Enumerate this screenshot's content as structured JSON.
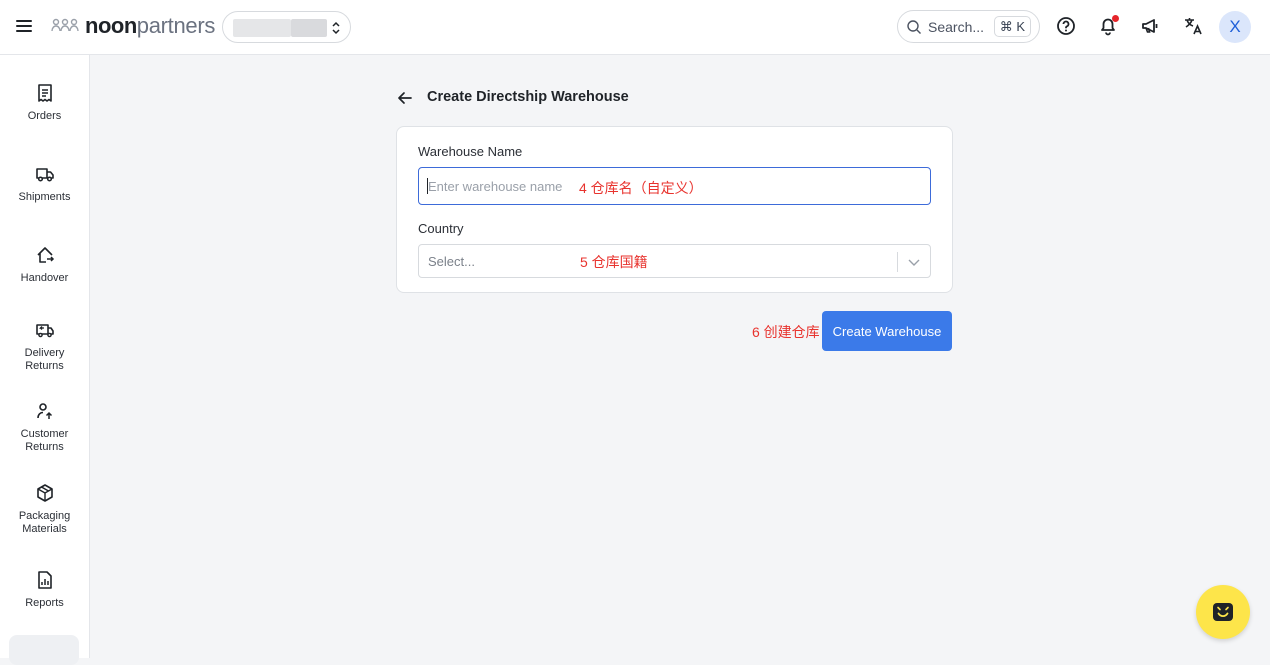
{
  "header": {
    "brand_bold": "noon",
    "brand_light": "partners",
    "search_placeholder": "Search...",
    "search_shortcut": "⌘ K",
    "avatar_initial": "X"
  },
  "sidebar": {
    "items": [
      {
        "label": "Orders",
        "icon": "receipt-icon"
      },
      {
        "label": "Shipments",
        "icon": "truck-icon"
      },
      {
        "label": "Handover",
        "icon": "home-arrow-icon"
      },
      {
        "label": "Delivery Returns",
        "icon": "truck-return-icon"
      },
      {
        "label": "Customer Returns",
        "icon": "person-return-icon"
      },
      {
        "label": "Packaging Materials",
        "icon": "box-icon"
      },
      {
        "label": "Reports",
        "icon": "report-icon"
      }
    ]
  },
  "page": {
    "title": "Create Directship Warehouse",
    "warehouse_name_label": "Warehouse Name",
    "warehouse_name_placeholder": "Enter warehouse name",
    "warehouse_name_value": "",
    "country_label": "Country",
    "country_placeholder": "Select...",
    "submit_label": "Create Warehouse"
  },
  "annotations": {
    "name": "4 仓库名（自定义）",
    "country": "5 仓库国籍",
    "create": "6 创建仓库"
  },
  "colors": {
    "primary": "#3b7ae9",
    "annotation": "#e8332e",
    "chat_fab": "#fde54a",
    "notification": "#e5252a"
  }
}
